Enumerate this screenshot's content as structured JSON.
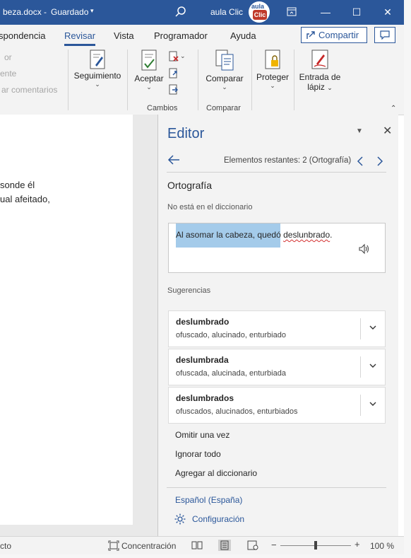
{
  "titlebar": {
    "document": "beza.docx",
    "separator": "-",
    "saved": "Guardado",
    "saved_caret": "▾",
    "user": "aula Clic",
    "avatar_top": "aula",
    "avatar_bottom": "Clic",
    "minimize": "—",
    "maximize": "☐",
    "close": "✕"
  },
  "ribbon_tabs": {
    "items": [
      "spondencia",
      "Revisar",
      "Vista",
      "Programador",
      "Ayuda"
    ],
    "active": "Revisar",
    "share": "Compartir"
  },
  "ribbon": {
    "faded_items": [
      "or",
      "ente",
      "ar comentarios"
    ],
    "seguimiento": "Seguimiento",
    "aceptar": "Aceptar",
    "cambios_group": "Cambios",
    "comparar": "Comparar",
    "comparar_group": "Comparar",
    "proteger": "Proteger",
    "entrada_line1": "Entrada de",
    "entrada_line2": "lápiz",
    "caret": "⌄",
    "collapse": "⌃"
  },
  "document": {
    "lines": [
      "sonde él",
      "ual afeitado,"
    ]
  },
  "editor": {
    "title": "Editor",
    "menu": "▼",
    "close": "✕",
    "remaining": "Elementos restantes: 2 (Ortografía)",
    "section": "Ortografía",
    "not_in_dictionary": "No está en el diccionario",
    "context_before": "Al asomar la cabeza, quedó ",
    "context_error": "deslunbrado",
    "context_after": ".",
    "suggestions_label": "Sugerencias",
    "suggestions": [
      {
        "word": "deslumbrado",
        "synonyms": "ofuscado, alucinado, enturbiado"
      },
      {
        "word": "deslumbrada",
        "synonyms": "ofuscada, alucinada, enturbiada"
      },
      {
        "word": "deslumbrados",
        "synonyms": "ofuscados, alucinados, enturbiados"
      }
    ],
    "actions": [
      "Omitir una vez",
      "Ignorar todo",
      "Agregar al diccionario"
    ],
    "language": "Español (España)",
    "settings": "Configuración"
  },
  "statusbar": {
    "left": "cto",
    "focus": "Concentración",
    "zoom_minus": "−",
    "zoom_plus": "+",
    "zoom": "100 %"
  },
  "colors": {
    "accent": "#2b579a",
    "highlight": "#a4cbea",
    "error_underline": "#d32f2f"
  }
}
